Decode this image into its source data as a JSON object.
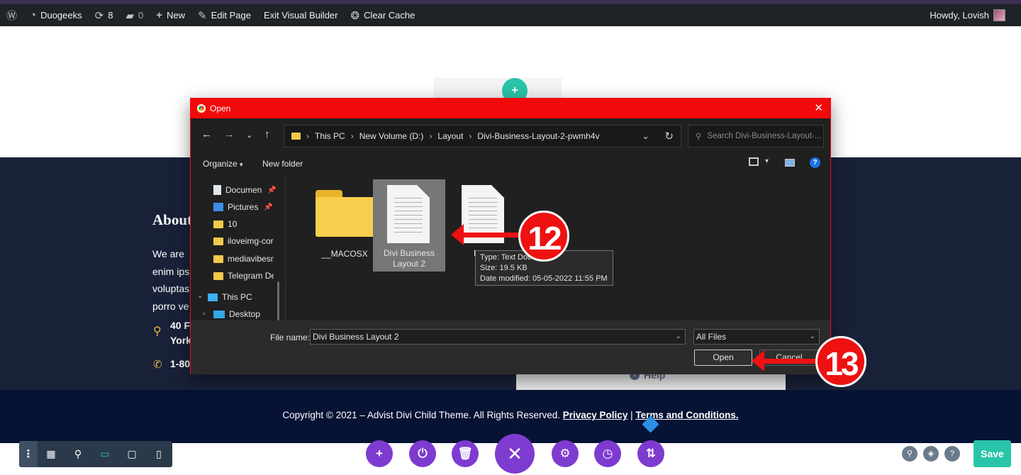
{
  "adminbar": {
    "site_name": "Duogeeks",
    "updates_count": "8",
    "comments_count": "0",
    "new_label": "New",
    "edit_page_label": "Edit Page",
    "exit_builder_label": "Exit Visual Builder",
    "clear_cache_label": "Clear Cache",
    "howdy_label": "Howdy, Lovish"
  },
  "page": {
    "footer_heading": "About",
    "footer_text_lines": [
      "We are",
      "enim ips",
      "voluptas",
      "porro ve"
    ],
    "address_lines": [
      "40 F",
      "York"
    ],
    "phone": "1-80",
    "help_label": "Help",
    "copyright_text": "Copyright © 2021 – Advist Divi Child Theme. All Rights Reserved. ",
    "privacy_link": "Privacy Policy",
    "separator": " | ",
    "terms_link": "Terms and Conditions."
  },
  "dialog": {
    "title": "Open",
    "breadcrumb": [
      "This PC",
      "New Volume (D:)",
      "Layout",
      "Divi-Business-Layout-2-pwmh4v"
    ],
    "search_placeholder": "Search Divi-Business-Layout-...",
    "organize_label": "Organize",
    "new_folder_label": "New folder",
    "nav_items": [
      {
        "label": "Documen",
        "icon": "document-icon",
        "pinned": true
      },
      {
        "label": "Pictures",
        "icon": "pictures-icon",
        "pinned": true
      },
      {
        "label": "10",
        "icon": "folder-icon",
        "pinned": false
      },
      {
        "label": "iloveimg-cor",
        "icon": "folder-icon",
        "pinned": false
      },
      {
        "label": "mediavibesnl",
        "icon": "folder-icon",
        "pinned": false
      },
      {
        "label": "Telegram De",
        "icon": "folder-icon",
        "pinned": false
      },
      {
        "label": "This PC",
        "icon": "computer-icon",
        "pinned": false
      },
      {
        "label": "Desktop",
        "icon": "desktop-icon",
        "pinned": false
      }
    ],
    "files": [
      {
        "name": "__MACOSX",
        "type": "folder"
      },
      {
        "name": "Divi Business Layout 2",
        "type": "document",
        "selected": true
      },
      {
        "name": "L",
        "type": "document"
      }
    ],
    "tooltip": {
      "type": "Type: Text Doc",
      "size": "Size: 19.5 KB",
      "modified": "Date modified: 05-05-2022 11:55 PM"
    },
    "file_name_label": "File name:",
    "file_name_value": "Divi Business Layout 2",
    "file_type_value": "All Files",
    "open_button": "Open",
    "cancel_button": "Cancel"
  },
  "annotations": {
    "step_a": "12",
    "step_b": "13",
    "color": "#ee1111"
  },
  "builder": {
    "save_label": "Save",
    "accent_purple": "#7e3bd0",
    "accent_teal": "#29c4a9"
  }
}
